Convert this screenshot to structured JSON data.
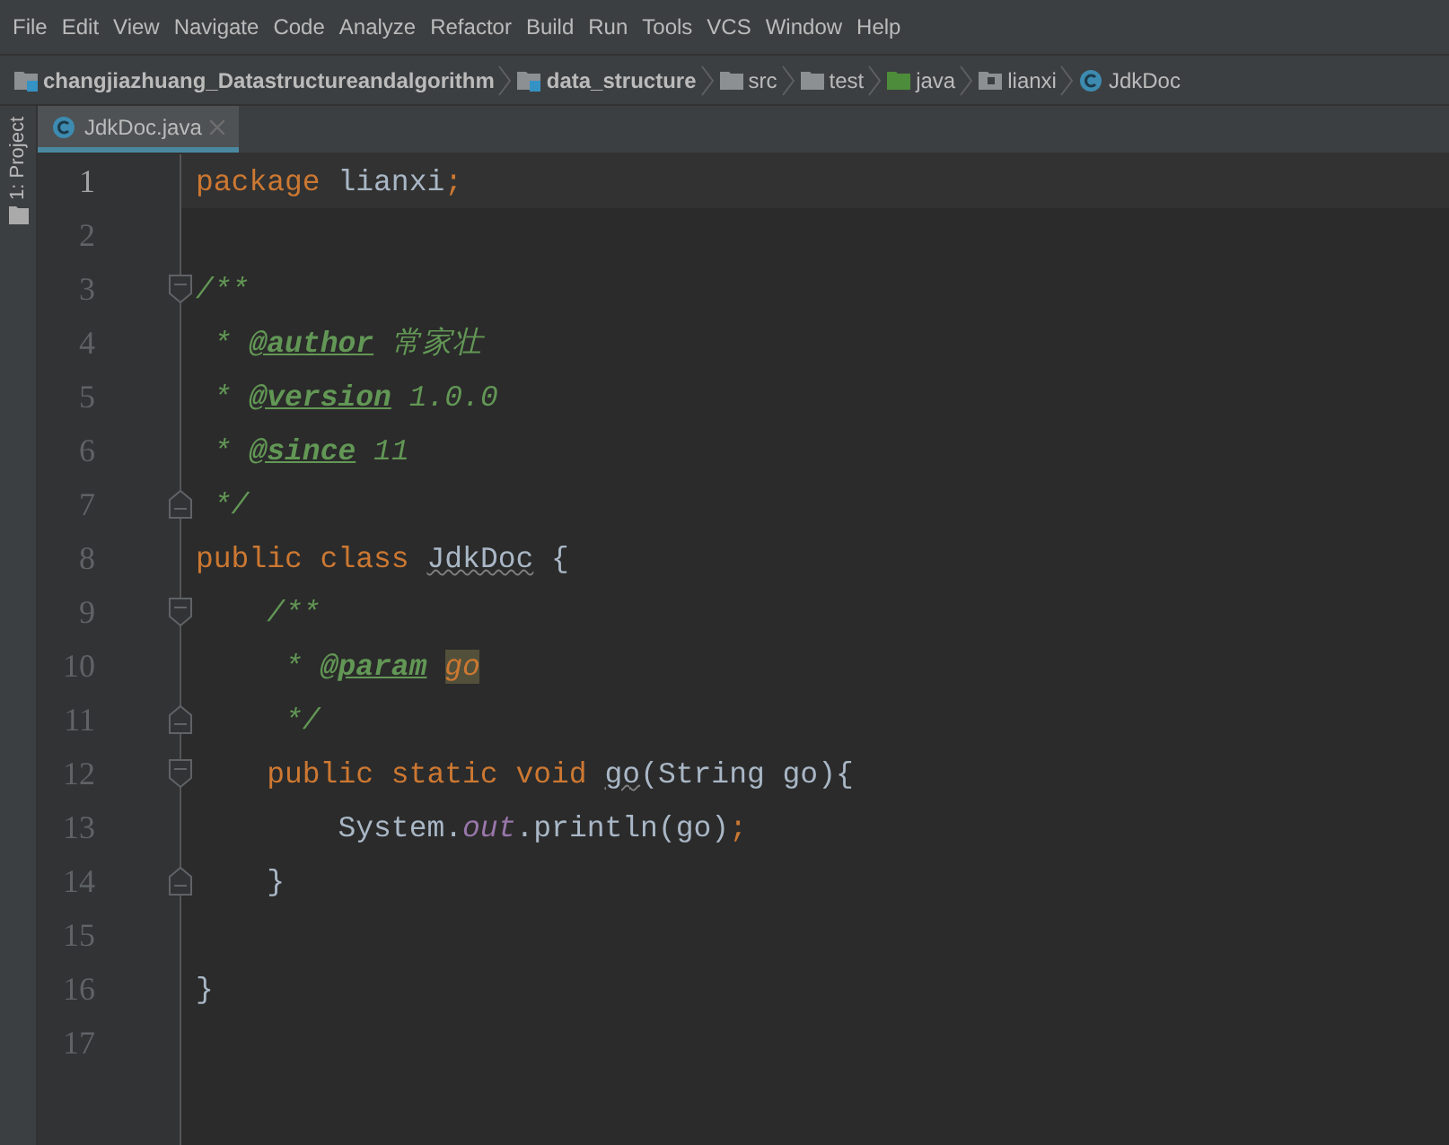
{
  "menu_bar": [
    "File",
    "Edit",
    "View",
    "Navigate",
    "Code",
    "Analyze",
    "Refactor",
    "Build",
    "Run",
    "Tools",
    "VCS",
    "Window",
    "Help"
  ],
  "breadcrumbs": [
    {
      "label": "changjiazhuang_Datastructureandalgorithm",
      "kind": "module"
    },
    {
      "label": "data_structure",
      "kind": "module"
    },
    {
      "label": "src",
      "kind": "folder"
    },
    {
      "label": "test",
      "kind": "folder"
    },
    {
      "label": "java",
      "kind": "source"
    },
    {
      "label": "lianxi",
      "kind": "package"
    },
    {
      "label": "JdkDoc",
      "kind": "class"
    }
  ],
  "side_tool": {
    "label": "1: Project"
  },
  "tabs": [
    {
      "label": "JdkDoc.java",
      "selected": true
    }
  ],
  "editor": {
    "lines": [
      {
        "number": "1",
        "selected": true,
        "fold_start": false,
        "fold_end": false,
        "tokens": [
          {
            "text": "package ",
            "kind": "kw"
          },
          {
            "text": "lianxi",
            "kind": "plain"
          },
          {
            "text": ";",
            "kind": "kw"
          }
        ]
      },
      {
        "number": "2",
        "selected": false,
        "fold_start": false,
        "fold_end": false
      },
      {
        "number": "3",
        "selected": false,
        "fold_start": true,
        "fold_end": false,
        "tokens": [
          {
            "text": "/**",
            "kind": "comment"
          }
        ]
      },
      {
        "number": "4",
        "selected": false,
        "fold_start": false,
        "fold_end": false,
        "tokens": [
          {
            "text": " * ",
            "kind": "comment"
          },
          {
            "text": "@author",
            "kind": "tag"
          },
          {
            "text": " 常家壮",
            "kind": "comment"
          }
        ]
      },
      {
        "number": "5",
        "selected": false,
        "fold_start": false,
        "fold_end": false,
        "tokens": [
          {
            "text": " * ",
            "kind": "comment"
          },
          {
            "text": "@version",
            "kind": "tag"
          },
          {
            "text": " 1.0.0",
            "kind": "comment"
          }
        ]
      },
      {
        "number": "6",
        "selected": false,
        "fold_start": false,
        "fold_end": false,
        "tokens": [
          {
            "text": " * ",
            "kind": "comment"
          },
          {
            "text": "@since",
            "kind": "tag"
          },
          {
            "text": " 11",
            "kind": "comment"
          }
        ]
      },
      {
        "number": "7",
        "selected": false,
        "fold_start": false,
        "fold_end": true,
        "tokens": [
          {
            "text": " */",
            "kind": "comment"
          }
        ]
      },
      {
        "number": "8",
        "selected": false,
        "fold_start": false,
        "fold_end": false,
        "tokens": [
          {
            "text": "public class ",
            "kind": "kw"
          },
          {
            "text": "JdkDoc",
            "kind": "warn"
          },
          {
            "text": " {",
            "kind": "plain"
          }
        ]
      },
      {
        "number": "9",
        "selected": false,
        "fold_start": true,
        "fold_end": false,
        "tokens": [
          {
            "text": "    /**",
            "kind": "comment"
          }
        ]
      },
      {
        "number": "10",
        "selected": false,
        "fold_start": false,
        "fold_end": false,
        "tokens": [
          {
            "text": "     * ",
            "kind": "comment"
          },
          {
            "text": "@param",
            "kind": "tag"
          },
          {
            "text": "go",
            "kind": "ref"
          }
        ]
      },
      {
        "number": "11",
        "selected": false,
        "fold_start": false,
        "fold_end": true,
        "tokens": [
          {
            "text": "     */",
            "kind": "comment"
          }
        ]
      },
      {
        "number": "12",
        "selected": false,
        "fold_start": true,
        "fold_end": false,
        "tokens": [
          {
            "text": "    public static void ",
            "kind": "kw"
          },
          {
            "text": "go",
            "kind": "warn"
          },
          {
            "text": "(String go){",
            "kind": "plain"
          }
        ]
      },
      {
        "number": "13",
        "selected": false,
        "fold_start": false,
        "fold_end": false,
        "tokens": [
          {
            "text": "        System.",
            "kind": "plain"
          },
          {
            "text": "out",
            "kind": "field"
          },
          {
            "text": ".println(go)",
            "kind": "plain"
          },
          {
            "text": ";",
            "kind": "kw"
          }
        ]
      },
      {
        "number": "14",
        "selected": false,
        "fold_start": false,
        "fold_end": true,
        "tokens": [
          {
            "text": "    }",
            "kind": "plain"
          }
        ]
      },
      {
        "number": "15",
        "selected": false,
        "fold_start": false,
        "fold_end": false
      },
      {
        "number": "16",
        "selected": false,
        "fold_start": false,
        "fold_end": false,
        "tokens": [
          {
            "text": "}",
            "kind": "plain"
          }
        ]
      },
      {
        "number": "17",
        "selected": false,
        "fold_start": false,
        "fold_end": false
      }
    ]
  }
}
